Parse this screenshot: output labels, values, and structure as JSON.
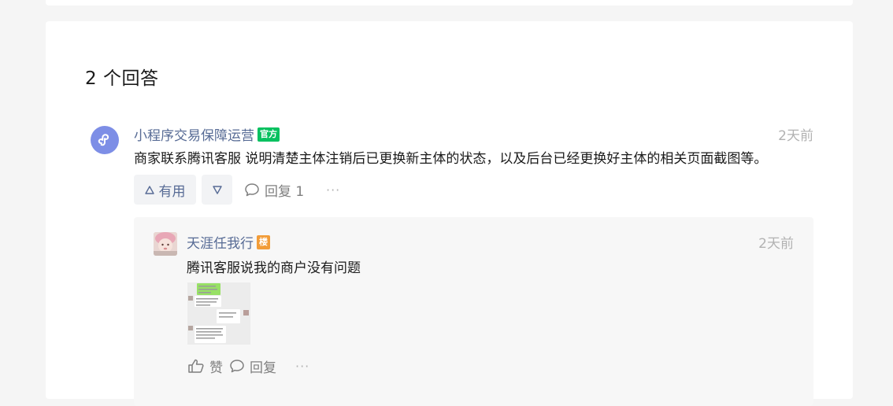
{
  "answers": {
    "heading": "2 个回答",
    "items": [
      {
        "author": "小程序交易保障运营",
        "badge": "官方",
        "time": "2天前",
        "body": "商家联系腾讯客服 说明清楚主体注销后已更换新主体的状态，以及后台已经更换好主体的相关页面截图等。",
        "actions": {
          "useful_label": "有用",
          "useless_icon": "triangle-down-icon",
          "reply_label": "回复 1",
          "more_label": "···"
        },
        "replies": [
          {
            "author": "天涯任我行",
            "badge": "楼",
            "time": "2天前",
            "body": "腾讯客服说我的商户没有问题",
            "actions": {
              "like_label": "赞",
              "reply_label": "回复",
              "more_label": "···"
            }
          }
        ]
      }
    ]
  },
  "colors": {
    "link": "#576b95",
    "official": "#07c160",
    "floor": "#f29c38",
    "muted": "#b2b2b2"
  }
}
